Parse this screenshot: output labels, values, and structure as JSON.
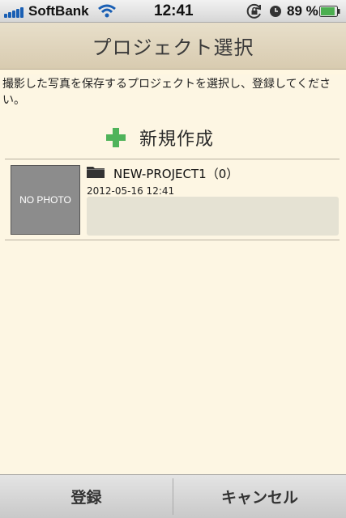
{
  "status_bar": {
    "carrier": "SoftBank",
    "time": "12:41",
    "battery_percent": "89 %",
    "battery_level": 0.89,
    "icons": [
      "signal-bars",
      "wifi",
      "rotation-lock",
      "alarm",
      "battery"
    ]
  },
  "nav": {
    "title": "プロジェクト選択"
  },
  "instruction": "撮影した写真を保存するプロジェクトを選択し、登録してください。",
  "new_project": {
    "label": "新規作成",
    "icon": "plus-icon",
    "icon_color": "#4fb35a"
  },
  "projects": [
    {
      "thumbnail_label": "NO PHOTO",
      "name": "NEW-PROJECT1（0）",
      "date": "2012-05-16 12:41",
      "icon": "folder-icon"
    }
  ],
  "toolbar": {
    "register_label": "登録",
    "cancel_label": "キャンセル"
  },
  "colors": {
    "background": "#fdf6e3",
    "nav": "#ded3bb",
    "accent_green": "#4fb35a"
  }
}
